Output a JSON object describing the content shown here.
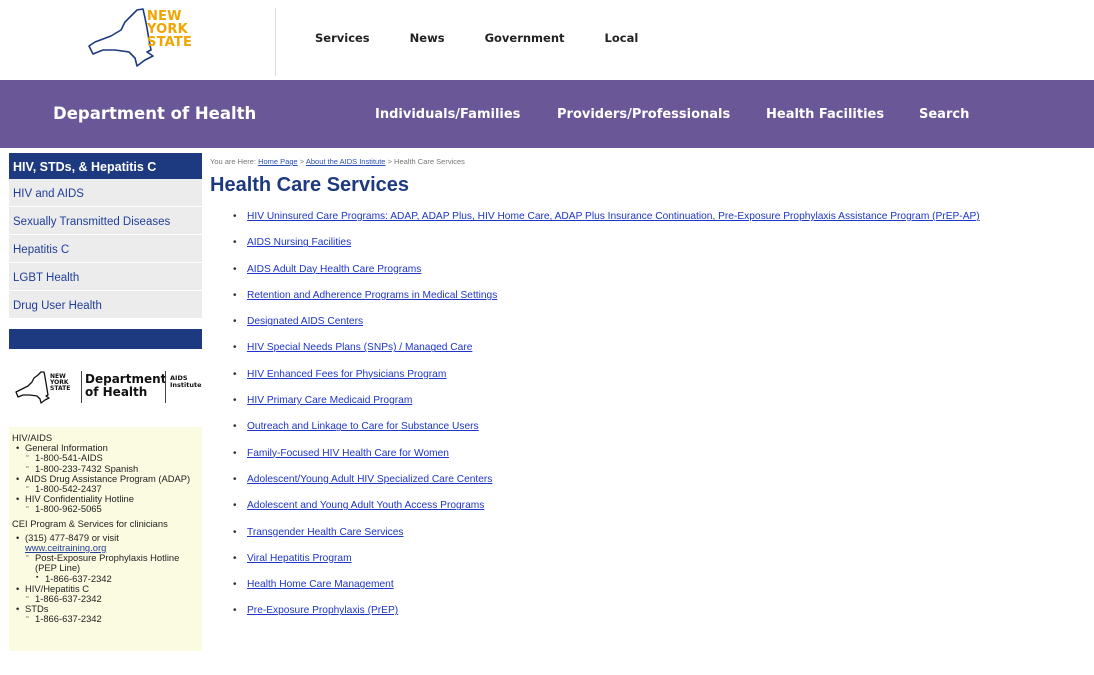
{
  "logo": {
    "lines": [
      "NEW",
      "YORK",
      "STATE"
    ]
  },
  "topnav": [
    "Services",
    "News",
    "Government",
    "Local"
  ],
  "agency_bar": {
    "title": "Department of Health",
    "nav": [
      "Individuals/Families",
      "Providers/Professionals",
      "Health Facilities",
      "Search"
    ]
  },
  "sidebar": {
    "heading": "HIV, STDs, & Hepatitis C",
    "items": [
      "HIV and AIDS",
      "Sexually Transmitted Diseases",
      "Hepatitis C",
      "LGBT Health",
      "Drug User Health"
    ]
  },
  "institute_logo": {
    "ny": [
      "NEW",
      "YORK",
      "STATE"
    ],
    "dept": [
      "Department",
      "of Health"
    ],
    "institute": [
      "AIDS",
      "Institute"
    ]
  },
  "contacts": {
    "hiv_heading": "HIV/AIDS",
    "general_info": "General Information",
    "phone_general": "1-800-541-AIDS",
    "phone_spanish": "1-800-233-7432 Spanish",
    "adap": "AIDS Drug Assistance Program (ADAP)",
    "phone_adap": "1-800-542-2437",
    "confidentiality": "HIV Confidentiality Hotline",
    "phone_conf": "1-800-962-5065",
    "cei_heading": "CEI Program & Services for clinicians",
    "cei_phone": "(315) 477-8479 or visit",
    "cei_link": "www.ceitraining.org",
    "pep": "Post-Exposure Prophylaxis Hotline (PEP Line)",
    "phone_pep": "1-866-637-2342",
    "hiv_hep": "HIV/Hepatitis C",
    "phone_hep": "1-866-637-2342",
    "stds": "STDs",
    "phone_std": "1-866-637-2342"
  },
  "breadcrumb": {
    "prefix": "You are Here: ",
    "home": "Home Page",
    "sep1": " > ",
    "aids": "About the AIDS Institute",
    "sep2": " > ",
    "current": "Health Care Services"
  },
  "page_title": "Health Care Services",
  "links": [
    "HIV Uninsured Care Programs: ADAP, ADAP Plus, HIV Home Care, ADAP Plus Insurance Continuation, Pre-Exposure Prophylaxis Assistance Program (PrEP-AP)",
    "AIDS Nursing Facilities",
    "AIDS Adult Day Health Care Programs",
    "Retention and Adherence Programs in Medical Settings",
    "Designated AIDS Centers",
    "HIV Special Needs Plans (SNPs) / Managed Care",
    "HIV Enhanced Fees for Physicians Program",
    "HIV Primary Care Medicaid Program",
    "Outreach and Linkage to Care for Substance Users",
    "Family-Focused HIV Health Care for Women",
    "Adolescent/Young Adult HIV Specialized Care Centers",
    "Adolescent and Young Adult Youth Access Programs",
    "Transgender Health Care Services",
    "Viral Hepatitis Program",
    "Health Home Care Management",
    "Pre-Exposure Prophylaxis (PrEP)"
  ]
}
